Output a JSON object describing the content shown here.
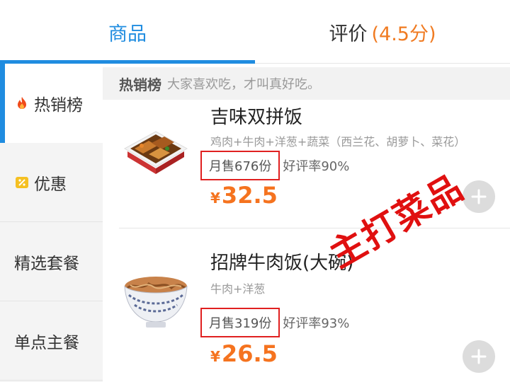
{
  "tabs": {
    "goods_label": "商品",
    "reviews_label": "评价",
    "reviews_score": "(4.5分)"
  },
  "sidebar": {
    "items": [
      {
        "label": "热销榜",
        "icon": "flame-icon",
        "active": true
      },
      {
        "label": "优惠",
        "icon": "discount-tag-icon",
        "active": false
      },
      {
        "label": "精选套餐",
        "icon": "",
        "active": false
      },
      {
        "label": "单点主餐",
        "icon": "",
        "active": false
      }
    ]
  },
  "section": {
    "title": "热销榜",
    "subtitle": "大家喜欢吃，才叫真好吃。"
  },
  "dishes": [
    {
      "name": "吉味双拼饭",
      "description": "鸡肉+牛肉+洋葱+蔬菜（西兰花、胡萝卜、菜花）",
      "sales": "月售676份",
      "rating": "好评率90%",
      "currency": "¥",
      "price": "32.5",
      "image": "bento-rice-image"
    },
    {
      "name": "招牌牛肉饭(大碗)",
      "description": "牛肉+洋葱",
      "sales": "月售319份",
      "rating": "好评率93%",
      "currency": "¥",
      "price": "26.5",
      "image": "beef-bowl-image"
    }
  ],
  "annotation": {
    "text": "主打菜品"
  },
  "colors": {
    "accent": "#1f8ce0",
    "price": "#f5731f",
    "score": "#f07b22",
    "annotation": "#e01010"
  }
}
